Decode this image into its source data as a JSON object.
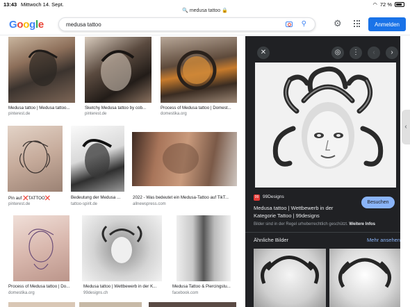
{
  "status": {
    "time": "13:43",
    "date": "Mittwoch 14. Sept.",
    "url": "medusa tattoo",
    "battery": "72 %"
  },
  "header": {
    "logo": [
      "G",
      "o",
      "o",
      "g",
      "l",
      "e"
    ],
    "query": "medusa tattoo",
    "login_label": "Anmelden"
  },
  "results": [
    {
      "caption": "Medusa tattoo | Medusa tattoo...",
      "source": "pinterest.de"
    },
    {
      "caption": "Sketchy Medusa tattoo by cob...",
      "source": "pinterest.de"
    },
    {
      "caption": "Process of Medusa tattoo | Domest...",
      "source": "domestika.org"
    },
    {
      "caption": "Pin auf ❌TATTOO❌",
      "source": "pinterest.de"
    },
    {
      "caption": "Bedeutung der Medusa ...",
      "source": "tattoo-spirit.de"
    },
    {
      "caption": "2022 - Was bedeutet ein Medusa-Tattoo auf TikT...",
      "source": "allnewspress.com"
    },
    {
      "caption": "Process of Medusa tattoo | Do...",
      "source": "domestika.org"
    },
    {
      "caption": "Medusa tattoo | Wettbewerb in der K...",
      "source": "99designs.ch"
    },
    {
      "caption": "Medusa Tattoo & Piercingstu...",
      "source": "facebook.com"
    }
  ],
  "panel": {
    "site": "99Designs",
    "favicon": "99",
    "title": "Medusa tattoo | Wettbewerb in der Kategorie Tattoo | 99designs",
    "visit_label": "Besuchen",
    "copyright": "Bilder sind in der Regel urheberrechtlich geschützt.",
    "more_info": "Weitere Infos",
    "similar_label": "Ähnliche Bilder",
    "see_more": "Mehr ansehen"
  },
  "colors": {
    "accent": "#1a73e8",
    "panel_bg": "#202124",
    "link_dark": "#8ab4f8"
  }
}
